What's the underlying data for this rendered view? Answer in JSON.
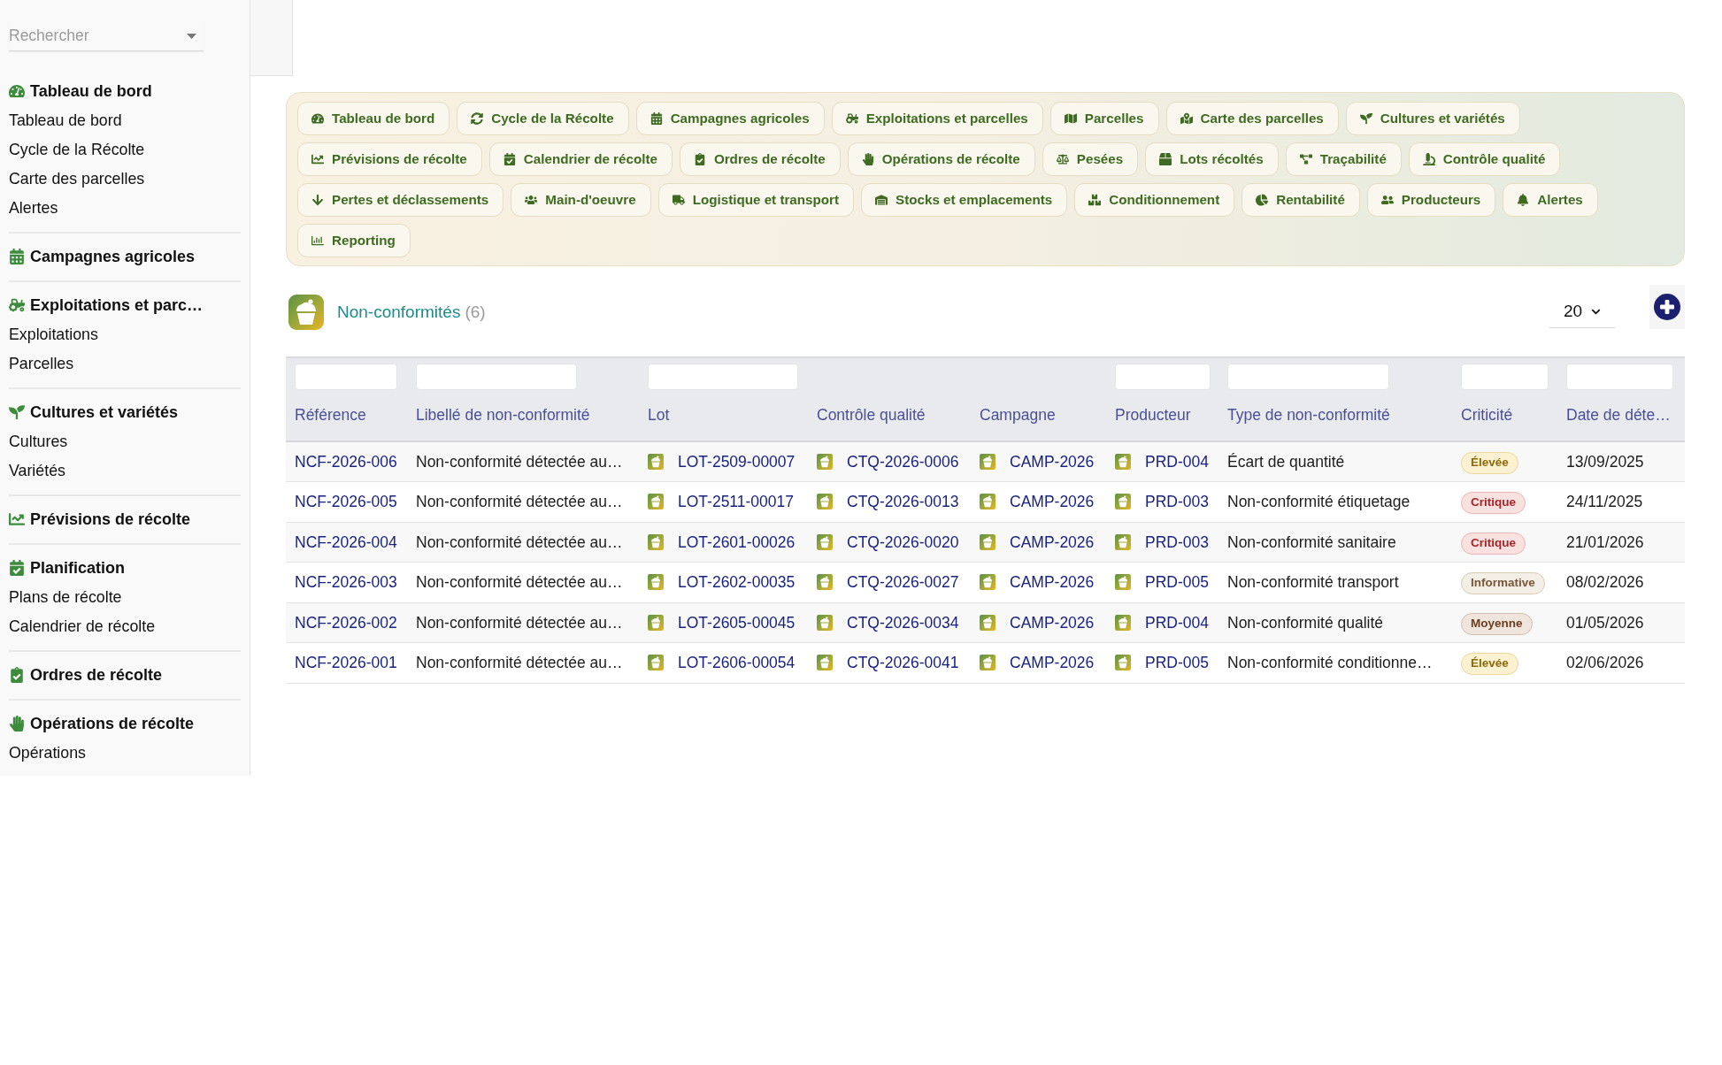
{
  "sidebar": {
    "search": {
      "placeholder": "Rechercher"
    },
    "sections": [
      {
        "title": "Tableau de bord",
        "items": [
          "Tableau de bord",
          "Cycle de la Récolte",
          "Carte des parcelles",
          "Alertes"
        ]
      },
      {
        "title": "Campagnes agricoles"
      },
      {
        "title": "Exploitations et parc…",
        "items": [
          "Exploitations",
          "Parcelles"
        ]
      },
      {
        "title": "Cultures et variétés",
        "items": [
          "Cultures",
          "Variétés"
        ]
      },
      {
        "title": "Prévisions de récolte"
      },
      {
        "title": "Planification",
        "items": [
          "Plans de récolte",
          "Calendrier de récolte"
        ]
      },
      {
        "title": "Ordres de récolte"
      },
      {
        "title": "Opérations de récolte",
        "items": [
          "Opérations"
        ]
      }
    ]
  },
  "nav_pills": [
    "Tableau de bord",
    "Cycle de la Récolte",
    "Campagnes agricoles",
    "Exploitations et parcelles",
    "Parcelles",
    "Carte des parcelles",
    "Cultures et variétés",
    "Prévisions de récolte",
    "Calendrier de récolte",
    "Ordres de récolte",
    "Opérations de récolte",
    "Pesées",
    "Lots récoltés",
    "Traçabilité",
    "Contrôle qualité",
    "Pertes et déclassements",
    "Main-d'oeuvre",
    "Logistique et transport",
    "Stocks et emplacements",
    "Conditionnement",
    "Rentabilité",
    "Producteurs",
    "Alertes",
    "Reporting"
  ],
  "list_header": {
    "title": "Non-conformités",
    "count": "(6)",
    "page_size": "20"
  },
  "table": {
    "columns": [
      {
        "label": "Référence",
        "filter": true
      },
      {
        "label": "Libellé de non-conformité",
        "filter": true
      },
      {
        "label": "Lot",
        "filter": true
      },
      {
        "label": "Contrôle qualité",
        "filter": false
      },
      {
        "label": "Campagne",
        "filter": false
      },
      {
        "label": "Producteur",
        "filter": true
      },
      {
        "label": "Type de non-conformité",
        "filter": true
      },
      {
        "label": "Criticité",
        "filter": true
      },
      {
        "label": "Date de déte…",
        "filter": true
      }
    ],
    "rows": [
      {
        "reference": "NCF-2026-006",
        "label": "Non-conformité détectée au…",
        "lot": "LOT-2509-00007",
        "quality_control": "CTQ-2026-0006",
        "campaign": "CAMP-2026",
        "producer": "PRD-004",
        "type": "Écart de quantité",
        "criticality": {
          "label": "Élevée",
          "kind": "high"
        },
        "date": "13/09/2025"
      },
      {
        "reference": "NCF-2026-005",
        "label": "Non-conformité détectée au…",
        "lot": "LOT-2511-00017",
        "quality_control": "CTQ-2026-0013",
        "campaign": "CAMP-2026",
        "producer": "PRD-003",
        "type": "Non-conformité étiquetage",
        "criticality": {
          "label": "Critique",
          "kind": "critical"
        },
        "date": "24/11/2025"
      },
      {
        "reference": "NCF-2026-004",
        "label": "Non-conformité détectée au…",
        "lot": "LOT-2601-00026",
        "quality_control": "CTQ-2026-0020",
        "campaign": "CAMP-2026",
        "producer": "PRD-003",
        "type": "Non-conformité sanitaire",
        "criticality": {
          "label": "Critique",
          "kind": "critical"
        },
        "date": "21/01/2026"
      },
      {
        "reference": "NCF-2026-003",
        "label": "Non-conformité détectée au…",
        "lot": "LOT-2602-00035",
        "quality_control": "CTQ-2026-0027",
        "campaign": "CAMP-2026",
        "producer": "PRD-005",
        "type": "Non-conformité transport",
        "criticality": {
          "label": "Informative",
          "kind": "info"
        },
        "date": "08/02/2026"
      },
      {
        "reference": "NCF-2026-002",
        "label": "Non-conformité détectée au…",
        "lot": "LOT-2605-00045",
        "quality_control": "CTQ-2026-0034",
        "campaign": "CAMP-2026",
        "producer": "PRD-004",
        "type": "Non-conformité qualité",
        "criticality": {
          "label": "Moyenne",
          "kind": "medium"
        },
        "date": "01/05/2026"
      },
      {
        "reference": "NCF-2026-001",
        "label": "Non-conformité détectée au…",
        "lot": "LOT-2606-00054",
        "quality_control": "CTQ-2026-0041",
        "campaign": "CAMP-2026",
        "producer": "PRD-005",
        "type": "Non-conformité conditionne…",
        "criticality": {
          "label": "Élevée",
          "kind": "high"
        },
        "date": "02/06/2026"
      }
    ]
  }
}
